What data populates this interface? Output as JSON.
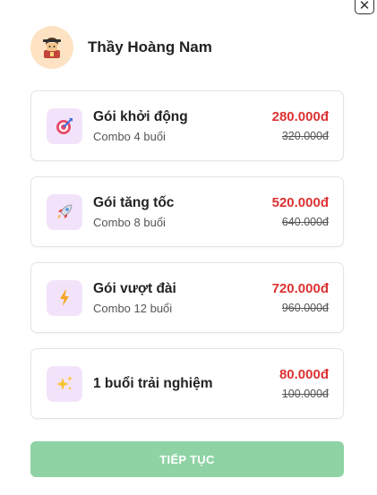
{
  "header": {
    "teacher_name": "Thầy Hoàng Nam",
    "avatar_icon": "teacher-avatar-icon"
  },
  "close_label": "✕",
  "packages": [
    {
      "name": "Gói khởi động",
      "sub": "Combo 4 buổi",
      "price": "280.000đ",
      "old_price": "320.000đ",
      "icon": "target-icon"
    },
    {
      "name": "Gói tăng tốc",
      "sub": "Combo 8 buổi",
      "price": "520.000đ",
      "old_price": "640.000đ",
      "icon": "rocket-icon"
    },
    {
      "name": "Gói vượt đài",
      "sub": "Combo 12 buổi",
      "price": "720.000đ",
      "old_price": "960.000đ",
      "icon": "lightning-icon"
    },
    {
      "name": "1 buổi trải nghiệm",
      "price": "80.000đ",
      "old_price": "100.000đ",
      "icon": "sparkles-icon"
    }
  ],
  "continue_label": "TIẾP TỤC",
  "colors": {
    "price": "#dc3232",
    "button": "#8fd3a5",
    "icon_bg": "#f3e3fa",
    "avatar_bg": "#fde3c4"
  }
}
